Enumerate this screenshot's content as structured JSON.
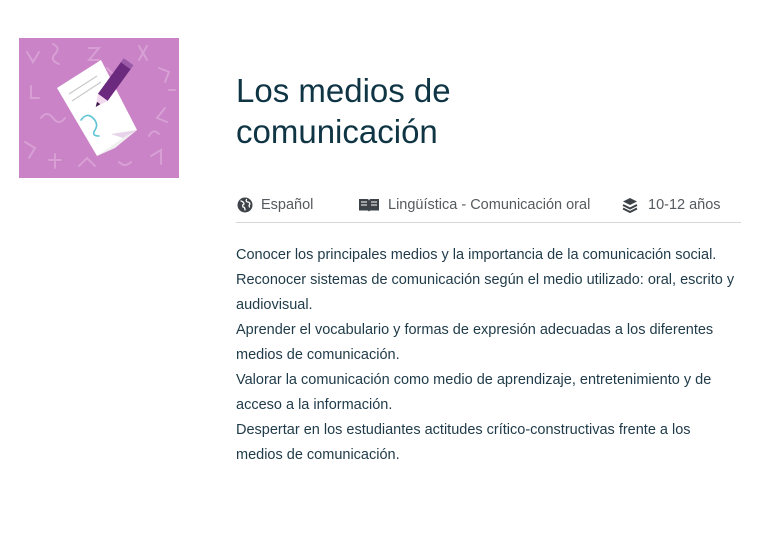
{
  "activity": {
    "title": "Los medios de comunicación",
    "thumbnail": {
      "icon": "paper-and-pencil-illustration",
      "background_color": "#c983c6"
    },
    "meta": {
      "language": {
        "icon": "globe-icon",
        "label": "Español"
      },
      "subject": {
        "icon": "book-icon",
        "label": "Lingüística - Comunicación oral"
      },
      "age": {
        "icon": "layers-icon",
        "label": "10-12 años"
      }
    },
    "objectives": [
      "Conocer los principales medios y la importancia de la comunicación social.",
      "Reconocer sistemas de comunicación según el medio utilizado: oral, escrito y audiovisual.",
      "Aprender el vocabulario y formas de expresión adecuadas a los diferentes medios de comunicación.",
      "Valorar la comunicación como medio de aprendizaje, entretenimiento y de acceso a la información.",
      "Despertar en los estudiantes actitudes crítico-constructivas frente a los medios de comunicación."
    ]
  },
  "colors": {
    "title": "#0f3545",
    "meta_text": "#555a5e",
    "body_text": "#1f3a48",
    "divider": "#d6d6d6",
    "thumbnail_bg": "#c983c6",
    "pencil": "#6b2a7e"
  }
}
